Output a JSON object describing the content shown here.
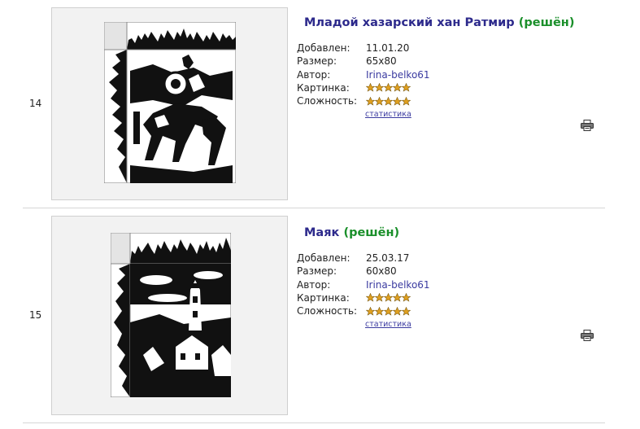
{
  "items": [
    {
      "number": "14",
      "title": "Младой хазарский хан Ратмир",
      "status": "(решён)",
      "fields": [
        {
          "label": "Добавлен:",
          "value": "11.01.20"
        },
        {
          "label": "Размер:",
          "value": "65x80"
        },
        {
          "label": "Автор:",
          "value": "Irina-belko61"
        }
      ],
      "picture_label": "Картинка:",
      "picture_rating": 5,
      "difficulty_label": "Сложность:",
      "difficulty_rating": 5,
      "stats_link": "статистика",
      "icons": [
        "print-icon"
      ]
    },
    {
      "number": "15",
      "title": "Маяк",
      "status": "(решён)",
      "fields": [
        {
          "label": "Добавлен:",
          "value": "25.03.17"
        },
        {
          "label": "Размер:",
          "value": "60x80"
        },
        {
          "label": "Автор:",
          "value": "Irina-belko61"
        }
      ],
      "picture_label": "Картинка:",
      "picture_rating": 5,
      "difficulty_label": "Сложность:",
      "difficulty_rating": 5,
      "stats_link": "статистика",
      "icons": [
        "print-icon"
      ]
    }
  ],
  "colors": {
    "title": "#2d2a8c",
    "solved": "#1a8f2a",
    "link": "#3a3aa0",
    "star": "#e0a020"
  }
}
